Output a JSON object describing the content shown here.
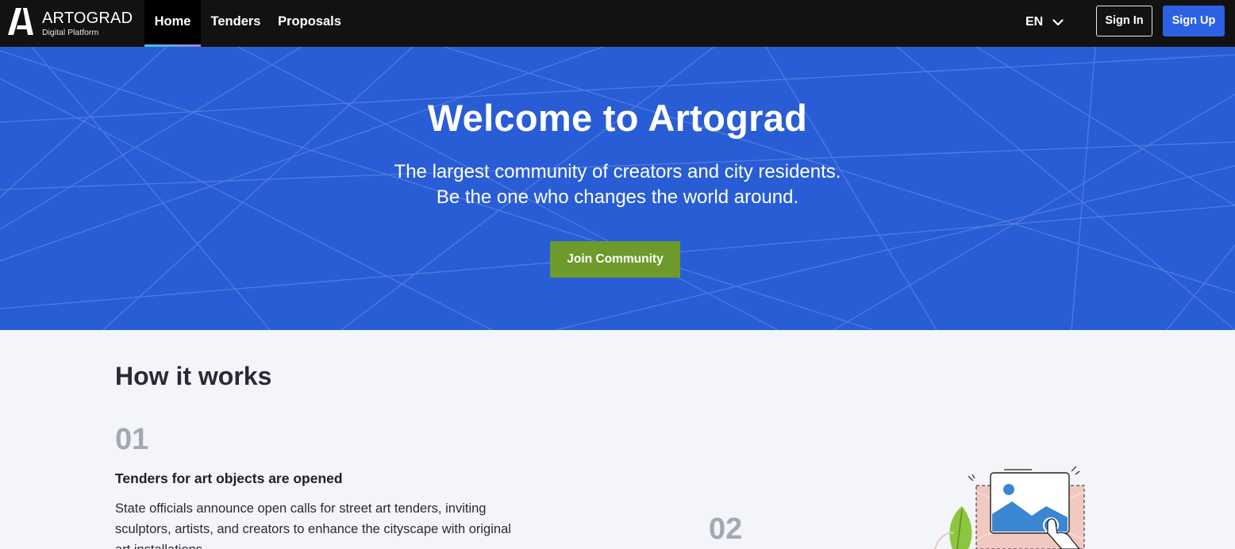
{
  "brand": {
    "name": "ARTOGRAD",
    "subtitle": "Digital Platform"
  },
  "nav": {
    "items": [
      {
        "label": "Home",
        "active": true
      },
      {
        "label": "Tenders",
        "active": false
      },
      {
        "label": "Proposals",
        "active": false
      }
    ],
    "language": "EN",
    "sign_in": "Sign In",
    "sign_up": "Sign Up"
  },
  "hero": {
    "title": "Welcome to Artograd",
    "subtitle_line1": "The largest community of creators and city residents.",
    "subtitle_line2": "Be the one who changes the world around.",
    "cta": "Join Community"
  },
  "how_it_works": {
    "title": "How it works",
    "steps": [
      {
        "number": "01",
        "heading": "Tenders for art objects are opened",
        "body": "State officials announce open calls for street art tenders, inviting sculptors, artists, and creators to enhance the cityscape with original art installations."
      },
      {
        "number": "02"
      }
    ]
  },
  "colors": {
    "navbar": "#121212",
    "hero_bg": "#295dd6",
    "primary_button": "#2c61e3",
    "cta_green": "#6d9a2b",
    "page_bg": "#f4f5f9",
    "step_number": "#a6a7b5"
  },
  "icons": [
    "logo-a-icon",
    "chevron-down-icon",
    "image-upload-illustration"
  ]
}
